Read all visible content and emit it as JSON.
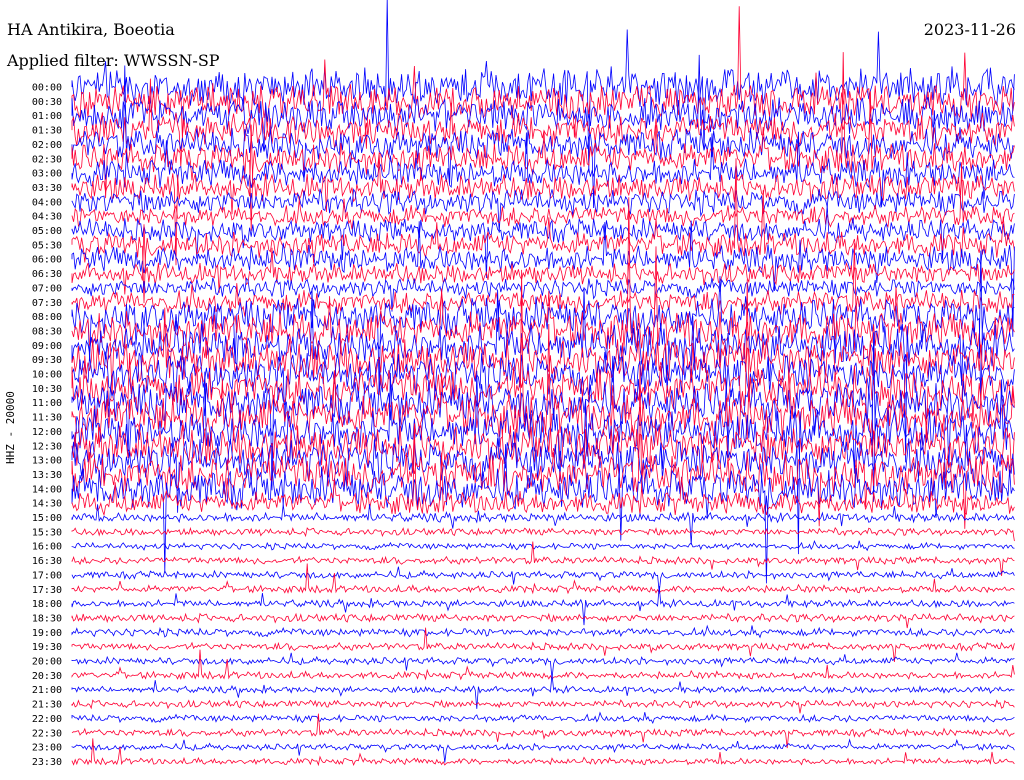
{
  "header": {
    "station": "HA Antikira, Boeotia",
    "date": "2023-11-26",
    "filter": "Applied filter: WWSSN-SP"
  },
  "chart_data": {
    "type": "line",
    "title": "HA Antikira, Boeotia",
    "ylabel": "HHZ - 20000",
    "row_labels": [
      "00:00",
      "00:30",
      "01:00",
      "01:30",
      "02:00",
      "02:30",
      "03:00",
      "03:30",
      "04:00",
      "04:30",
      "05:00",
      "05:30",
      "06:00",
      "06:30",
      "07:00",
      "07:30",
      "08:00",
      "08:30",
      "09:00",
      "09:30",
      "10:00",
      "10:30",
      "11:00",
      "11:30",
      "12:00",
      "12:30",
      "13:00",
      "13:30",
      "14:00",
      "14:30",
      "15:00",
      "15:30",
      "16:00",
      "16:30",
      "17:00",
      "17:30",
      "18:00",
      "18:30",
      "19:00",
      "19:30",
      "20:00",
      "20:30",
      "21:00",
      "21:30",
      "22:00",
      "22:30",
      "23:00",
      "23:30"
    ],
    "row_activity": [
      0.9,
      0.8,
      0.8,
      0.75,
      0.7,
      0.7,
      0.65,
      0.6,
      0.55,
      0.45,
      0.5,
      0.55,
      0.6,
      0.45,
      0.4,
      0.5,
      0.85,
      0.9,
      0.95,
      1.0,
      1.0,
      1.0,
      1.0,
      1.0,
      1.0,
      1.0,
      1.0,
      1.0,
      0.95,
      0.5,
      0.15,
      0.1,
      0.08,
      0.1,
      0.1,
      0.1,
      0.1,
      0.12,
      0.12,
      0.1,
      0.1,
      0.1,
      0.08,
      0.1,
      0.1,
      0.1,
      0.08,
      0.08
    ],
    "colors": [
      "#0000ff",
      "#ff0033"
    ]
  }
}
